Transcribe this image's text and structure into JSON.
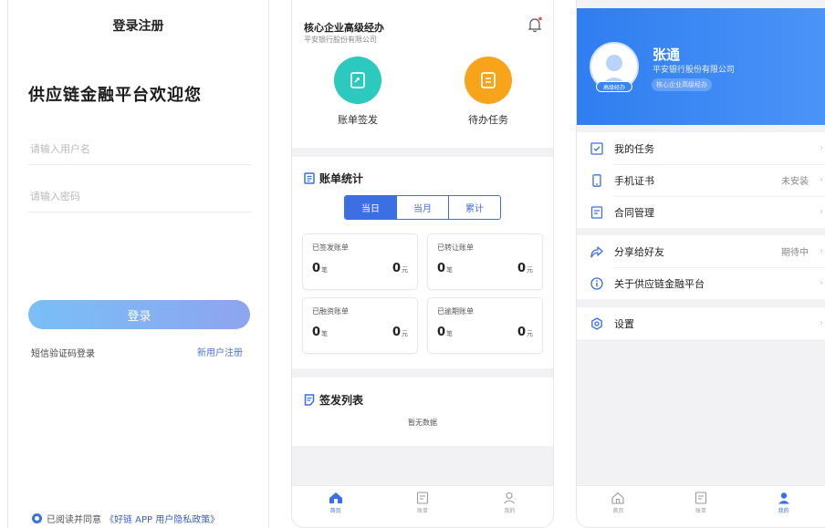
{
  "login": {
    "title": "登录注册",
    "welcome": "供应链金融平台欢迎您",
    "username_placeholder": "请输入用户名",
    "password_placeholder": "请输入密码",
    "login_button": "登录",
    "sms_login": "短信验证码登录",
    "register": "新用户注册",
    "agree_text": "已阅读并同意",
    "policy_link": "《好链 APP 用户隐私政策》"
  },
  "home": {
    "company_role": "核心企业高级经办",
    "bank_name": "平安银行股份有限公司",
    "actions": [
      {
        "label": "账单签发",
        "icon": "bill-issue-icon",
        "color": "#2bc9be"
      },
      {
        "label": "待办任务",
        "icon": "task-list-icon",
        "color": "#f7a41b"
      }
    ],
    "stats_title": "账单统计",
    "segments": [
      "当日",
      "当月",
      "累计"
    ],
    "active_segment": "当日",
    "cards": [
      {
        "title": "已签发账单",
        "left_value": "0",
        "left_unit": "笔",
        "right_value": "0",
        "right_unit": "元"
      },
      {
        "title": "已转让账单",
        "left_value": "0",
        "left_unit": "笔",
        "right_value": "0",
        "right_unit": "元"
      },
      {
        "title": "已融资账单",
        "left_value": "0",
        "left_unit": "笔",
        "right_value": "0",
        "right_unit": "元"
      },
      {
        "title": "已逾期账单",
        "left_value": "0",
        "left_unit": "笔",
        "right_value": "0",
        "right_unit": "元"
      }
    ],
    "list_title": "签发列表",
    "empty_text": "暂无数据"
  },
  "tabbar": {
    "tabs": [
      {
        "label": "首页",
        "icon": "home-icon"
      },
      {
        "label": "账单",
        "icon": "bill-icon"
      },
      {
        "label": "我的",
        "icon": "user-icon"
      }
    ],
    "accent": "#3b6fe3"
  },
  "profile": {
    "name": "张通",
    "bank": "平安银行股份有限公司",
    "role": "核心企业高级经办",
    "avatar_badge": "高级经办",
    "menu": [
      {
        "label": "我的任务",
        "icon": "checkbox-icon",
        "value": ""
      },
      {
        "label": "手机证书",
        "icon": "phone-icon",
        "value": "未安装"
      },
      {
        "label": "合同管理",
        "icon": "contract-icon",
        "value": ""
      },
      {
        "label": "分享给好友",
        "icon": "share-icon",
        "value": "期待中"
      },
      {
        "label": "关于供应链金融平台",
        "icon": "info-icon",
        "value": ""
      },
      {
        "label": "设置",
        "icon": "settings-icon",
        "value": ""
      }
    ]
  }
}
